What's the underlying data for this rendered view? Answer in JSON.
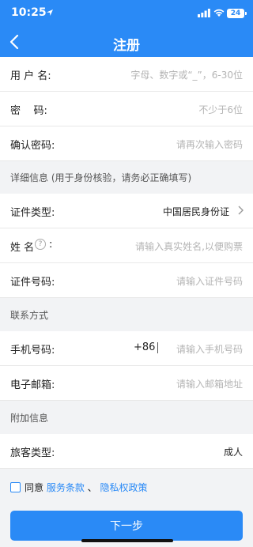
{
  "status_bar": {
    "time": "10:25",
    "battery": "24"
  },
  "nav": {
    "title": "注册"
  },
  "account": {
    "username": {
      "label": "用 户 名:",
      "placeholder": "字母、数字或“_”，6-30位"
    },
    "password": {
      "label": "密    码:",
      "placeholder": "不少于6位"
    },
    "confirm": {
      "label": "确认密码:",
      "placeholder": "请再次输入密码"
    }
  },
  "detail_section": {
    "title": "详细信息 (用于身份核验，请务必正确填写)"
  },
  "detail": {
    "id_type": {
      "label": "证件类型:",
      "value": "中国居民身份证"
    },
    "name": {
      "label": "姓 名",
      "help": "?",
      "colon": ":",
      "placeholder": "请输入真实姓名,以便购票"
    },
    "id_number": {
      "label": "证件号码:",
      "placeholder": "请输入证件号码"
    }
  },
  "contact_section": {
    "title": "联系方式"
  },
  "contact": {
    "phone": {
      "label": "手机号码:",
      "prefix": "+86",
      "placeholder": "请输入手机号码"
    },
    "email": {
      "label": "电子邮箱:",
      "placeholder": "请输入邮箱地址"
    }
  },
  "extra_section": {
    "title": "附加信息"
  },
  "extra": {
    "passenger_type": {
      "label": "旅客类型:",
      "value": "成人"
    }
  },
  "agreement": {
    "prefix": "同意 ",
    "terms": "服务条款",
    "sep": " 、 ",
    "privacy": "隐私权政策"
  },
  "next_button": {
    "label": "下一步"
  },
  "colors": {
    "accent": "#2a8af6",
    "background": "#f2f3f5"
  },
  "icons": {
    "back": "chevron-left-icon",
    "id_type_arrow": "chevron-right-icon",
    "help": "question-circle-icon"
  }
}
